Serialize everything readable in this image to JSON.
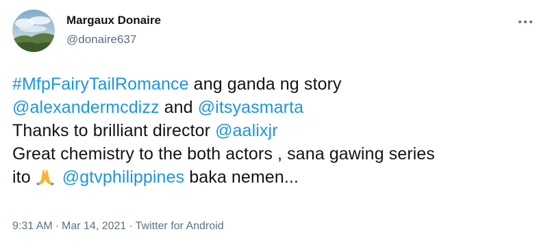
{
  "author": {
    "name": "Margaux Donaire",
    "handle": "@donaire637",
    "avatar_icon": "landscape-avatar"
  },
  "more_icon": "more-options-icon",
  "tweet": {
    "lines": [
      [
        {
          "text": "#MfpFairyTailRomance",
          "link": true
        },
        {
          "text": " ang ganda ng story",
          "link": false
        }
      ],
      [
        {
          "text": "@alexandermcdizz",
          "link": true
        },
        {
          "text": " and ",
          "link": false
        },
        {
          "text": "@itsyasmarta",
          "link": true
        }
      ],
      [
        {
          "text": "Thanks to brilliant director ",
          "link": false
        },
        {
          "text": "@aalixjr",
          "link": true
        }
      ],
      [
        {
          "text": "Great chemistry to the both actors , sana gawing series",
          "link": false
        }
      ],
      [
        {
          "text": "ito ",
          "link": false
        },
        {
          "emoji": "folded-hands-icon"
        },
        {
          "text": " ",
          "link": false
        },
        {
          "text": "@gtvphilippines",
          "link": true
        },
        {
          "text": " baka nemen...",
          "link": false
        }
      ]
    ]
  },
  "meta": {
    "time": "9:31 AM",
    "separator": "·",
    "date": "Mar 14, 2021",
    "source": "Twitter for Android"
  },
  "colors": {
    "link": "#1b95e0",
    "text": "#0f1419",
    "muted": "#5b7083"
  }
}
